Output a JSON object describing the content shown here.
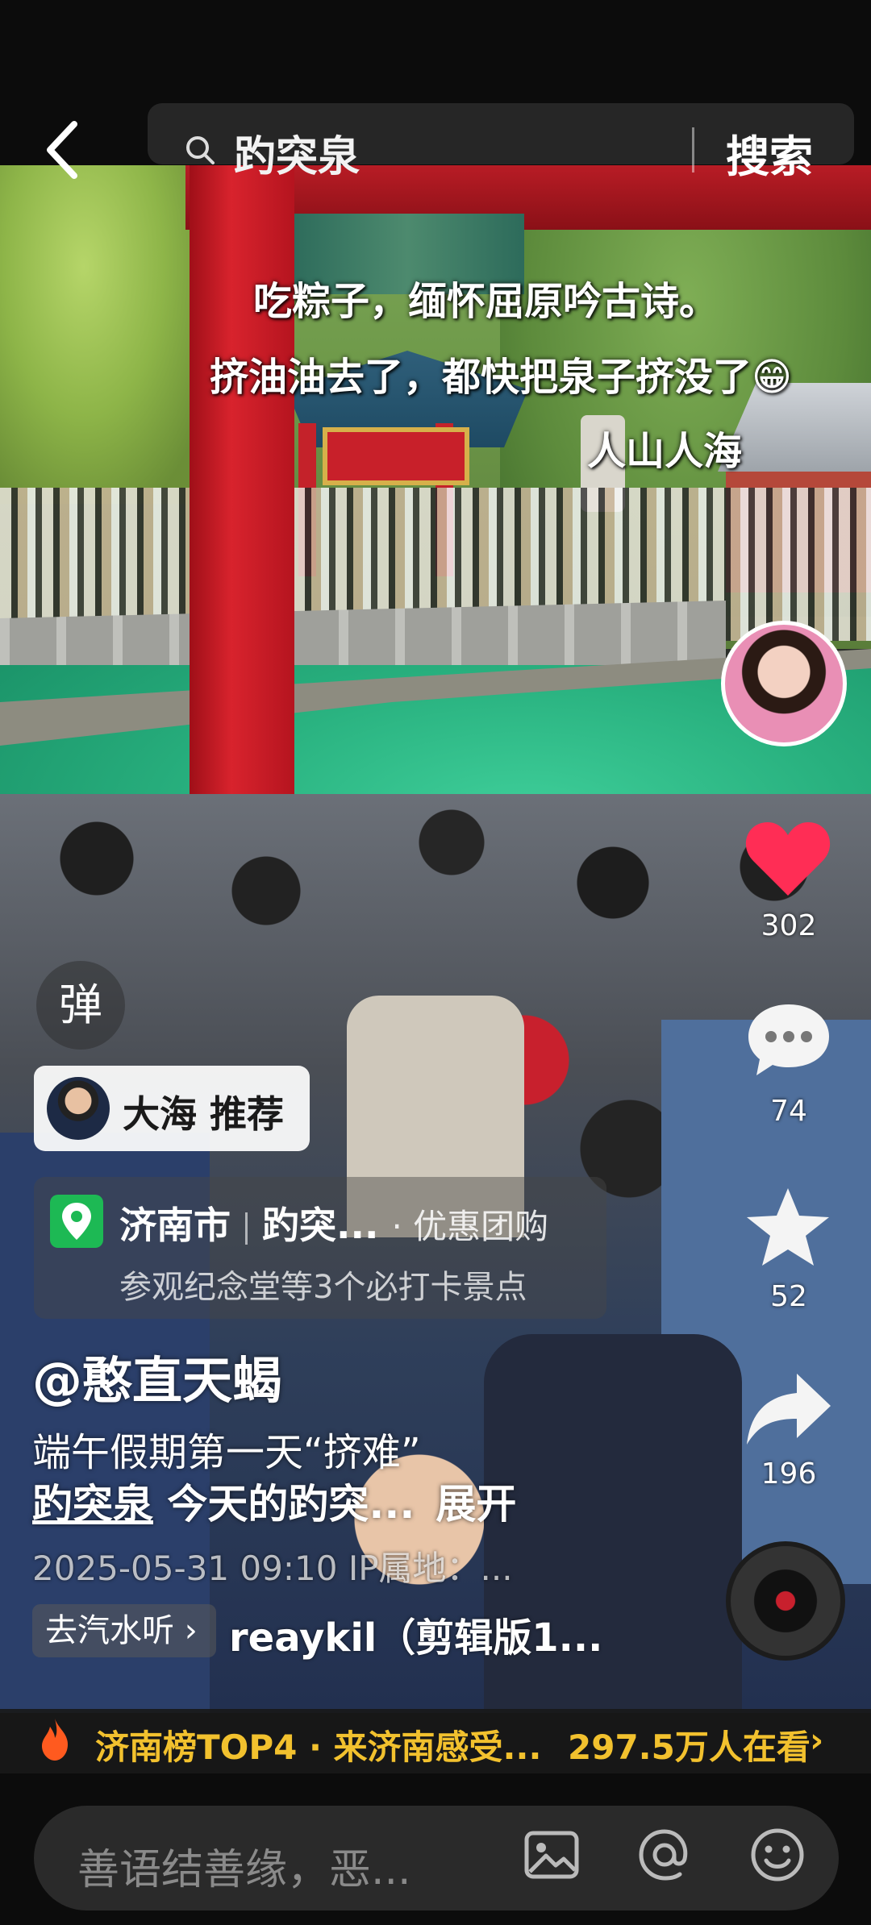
{
  "search": {
    "query": "趵突泉",
    "button_label": "搜索"
  },
  "captions": [
    "吃粽子，缅怀屈原吟古诗。",
    "挤油油去了，都快把泉子挤没了😁",
    "人山人海"
  ],
  "sidebar": {
    "like_count": "302",
    "comment_count": "74",
    "favorite_count": "52",
    "share_count": "196"
  },
  "danmu_label": "弹",
  "recommend": {
    "label": "大海 推荐"
  },
  "poi": {
    "city": "济南市",
    "place": "趵突...",
    "tag": "· 优惠团购",
    "subtitle": "参观纪念堂等3个必打卡景点"
  },
  "post": {
    "author": "@憨直天蝎",
    "line1": "端午假期第一天“挤难”",
    "hashtag": "趵突泉",
    "line2_rest": " 今天的趵突...",
    "expand": "展开",
    "meta": "2025-05-31 09:10  IP属地：..."
  },
  "music": {
    "chip": "去汽水听 ›",
    "title": "reaykil（剪辑版1..."
  },
  "hot": {
    "text": "济南榜TOP4 · 来济南感受...",
    "viewers": "297.5万人在看",
    "chevron": "›"
  },
  "comment": {
    "placeholder": "善语结善缘，恶..."
  },
  "colors": {
    "like": "#ff2d55",
    "hot": "#f2c12e",
    "poi": "#1db954"
  }
}
